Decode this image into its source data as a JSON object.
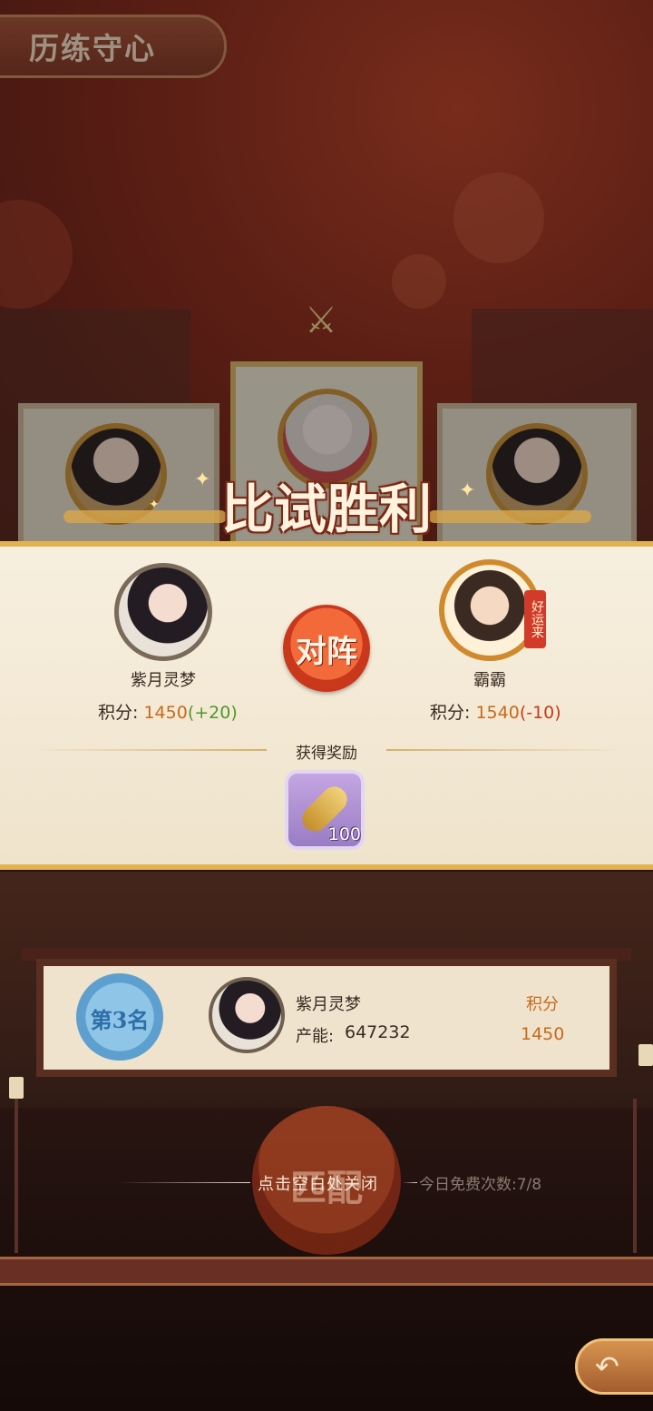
{
  "title": "历练守心",
  "result": {
    "victory_title": "比试胜利",
    "vs_label": "对阵",
    "player": {
      "name": "紫月灵梦",
      "score_label": "积分:",
      "score": "1450",
      "delta": "(+20)"
    },
    "opponent": {
      "name": "霸霸",
      "score_label": "积分:",
      "score": "1540",
      "delta": "(-10)",
      "badge": "好运来"
    },
    "reward_label": "获得奖励",
    "reward": {
      "icon": "vajra-icon",
      "count": "100"
    }
  },
  "rank_board": {
    "rank": "第3名",
    "name": "紫月灵梦",
    "power_label": "产能:",
    "power": "647232",
    "score_label": "积分",
    "score": "1450"
  },
  "match_button_label": "匹配",
  "close_hint": "点击空白处关闭",
  "free_count": "今日免费次数:7/8",
  "colors": {
    "accent_gold": "#e2b24f",
    "score_orange": "#c76a1a",
    "positive_green": "#4e9a2a",
    "negative_red": "#c73a1a",
    "vs_red": "#e6592b",
    "rank_blue": "#5d9fce"
  }
}
